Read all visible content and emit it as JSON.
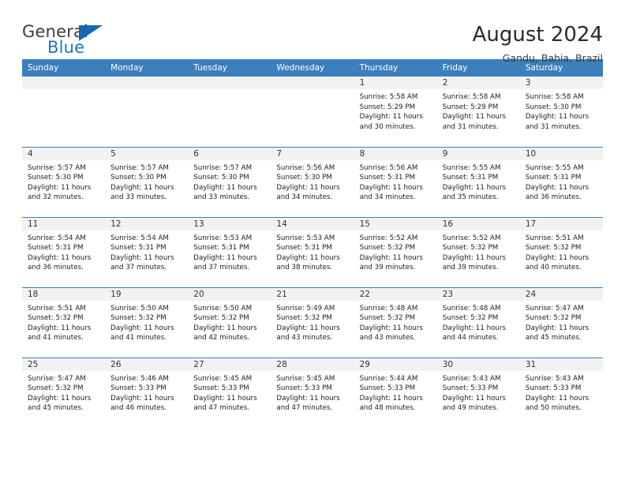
{
  "brand": {
    "word1": "General",
    "word2": "Blue",
    "triangle_color": "#1668b0"
  },
  "header": {
    "month_title": "August 2024",
    "location": "Gandu, Bahia, Brazil"
  },
  "colors": {
    "header_blue": "#3c7fbd",
    "date_band_gray": "#f2f2f2",
    "brand_blue": "#1c78c0"
  },
  "calendar": {
    "weekday_headers": [
      "Sunday",
      "Monday",
      "Tuesday",
      "Wednesday",
      "Thursday",
      "Friday",
      "Saturday"
    ],
    "weeks": [
      [
        {
          "day": "",
          "lines": []
        },
        {
          "day": "",
          "lines": []
        },
        {
          "day": "",
          "lines": []
        },
        {
          "day": "",
          "lines": []
        },
        {
          "day": "1",
          "lines": [
            "Sunrise: 5:58 AM",
            "Sunset: 5:29 PM",
            "Daylight: 11 hours",
            "and 30 minutes."
          ]
        },
        {
          "day": "2",
          "lines": [
            "Sunrise: 5:58 AM",
            "Sunset: 5:29 PM",
            "Daylight: 11 hours",
            "and 31 minutes."
          ]
        },
        {
          "day": "3",
          "lines": [
            "Sunrise: 5:58 AM",
            "Sunset: 5:30 PM",
            "Daylight: 11 hours",
            "and 31 minutes."
          ]
        }
      ],
      [
        {
          "day": "4",
          "lines": [
            "Sunrise: 5:57 AM",
            "Sunset: 5:30 PM",
            "Daylight: 11 hours",
            "and 32 minutes."
          ]
        },
        {
          "day": "5",
          "lines": [
            "Sunrise: 5:57 AM",
            "Sunset: 5:30 PM",
            "Daylight: 11 hours",
            "and 33 minutes."
          ]
        },
        {
          "day": "6",
          "lines": [
            "Sunrise: 5:57 AM",
            "Sunset: 5:30 PM",
            "Daylight: 11 hours",
            "and 33 minutes."
          ]
        },
        {
          "day": "7",
          "lines": [
            "Sunrise: 5:56 AM",
            "Sunset: 5:30 PM",
            "Daylight: 11 hours",
            "and 34 minutes."
          ]
        },
        {
          "day": "8",
          "lines": [
            "Sunrise: 5:56 AM",
            "Sunset: 5:31 PM",
            "Daylight: 11 hours",
            "and 34 minutes."
          ]
        },
        {
          "day": "9",
          "lines": [
            "Sunrise: 5:55 AM",
            "Sunset: 5:31 PM",
            "Daylight: 11 hours",
            "and 35 minutes."
          ]
        },
        {
          "day": "10",
          "lines": [
            "Sunrise: 5:55 AM",
            "Sunset: 5:31 PM",
            "Daylight: 11 hours",
            "and 36 minutes."
          ]
        }
      ],
      [
        {
          "day": "11",
          "lines": [
            "Sunrise: 5:54 AM",
            "Sunset: 5:31 PM",
            "Daylight: 11 hours",
            "and 36 minutes."
          ]
        },
        {
          "day": "12",
          "lines": [
            "Sunrise: 5:54 AM",
            "Sunset: 5:31 PM",
            "Daylight: 11 hours",
            "and 37 minutes."
          ]
        },
        {
          "day": "13",
          "lines": [
            "Sunrise: 5:53 AM",
            "Sunset: 5:31 PM",
            "Daylight: 11 hours",
            "and 37 minutes."
          ]
        },
        {
          "day": "14",
          "lines": [
            "Sunrise: 5:53 AM",
            "Sunset: 5:31 PM",
            "Daylight: 11 hours",
            "and 38 minutes."
          ]
        },
        {
          "day": "15",
          "lines": [
            "Sunrise: 5:52 AM",
            "Sunset: 5:32 PM",
            "Daylight: 11 hours",
            "and 39 minutes."
          ]
        },
        {
          "day": "16",
          "lines": [
            "Sunrise: 5:52 AM",
            "Sunset: 5:32 PM",
            "Daylight: 11 hours",
            "and 39 minutes."
          ]
        },
        {
          "day": "17",
          "lines": [
            "Sunrise: 5:51 AM",
            "Sunset: 5:32 PM",
            "Daylight: 11 hours",
            "and 40 minutes."
          ]
        }
      ],
      [
        {
          "day": "18",
          "lines": [
            "Sunrise: 5:51 AM",
            "Sunset: 5:32 PM",
            "Daylight: 11 hours",
            "and 41 minutes."
          ]
        },
        {
          "day": "19",
          "lines": [
            "Sunrise: 5:50 AM",
            "Sunset: 5:32 PM",
            "Daylight: 11 hours",
            "and 41 minutes."
          ]
        },
        {
          "day": "20",
          "lines": [
            "Sunrise: 5:50 AM",
            "Sunset: 5:32 PM",
            "Daylight: 11 hours",
            "and 42 minutes."
          ]
        },
        {
          "day": "21",
          "lines": [
            "Sunrise: 5:49 AM",
            "Sunset: 5:32 PM",
            "Daylight: 11 hours",
            "and 43 minutes."
          ]
        },
        {
          "day": "22",
          "lines": [
            "Sunrise: 5:48 AM",
            "Sunset: 5:32 PM",
            "Daylight: 11 hours",
            "and 43 minutes."
          ]
        },
        {
          "day": "23",
          "lines": [
            "Sunrise: 5:48 AM",
            "Sunset: 5:32 PM",
            "Daylight: 11 hours",
            "and 44 minutes."
          ]
        },
        {
          "day": "24",
          "lines": [
            "Sunrise: 5:47 AM",
            "Sunset: 5:32 PM",
            "Daylight: 11 hours",
            "and 45 minutes."
          ]
        }
      ],
      [
        {
          "day": "25",
          "lines": [
            "Sunrise: 5:47 AM",
            "Sunset: 5:32 PM",
            "Daylight: 11 hours",
            "and 45 minutes."
          ]
        },
        {
          "day": "26",
          "lines": [
            "Sunrise: 5:46 AM",
            "Sunset: 5:33 PM",
            "Daylight: 11 hours",
            "and 46 minutes."
          ]
        },
        {
          "day": "27",
          "lines": [
            "Sunrise: 5:45 AM",
            "Sunset: 5:33 PM",
            "Daylight: 11 hours",
            "and 47 minutes."
          ]
        },
        {
          "day": "28",
          "lines": [
            "Sunrise: 5:45 AM",
            "Sunset: 5:33 PM",
            "Daylight: 11 hours",
            "and 47 minutes."
          ]
        },
        {
          "day": "29",
          "lines": [
            "Sunrise: 5:44 AM",
            "Sunset: 5:33 PM",
            "Daylight: 11 hours",
            "and 48 minutes."
          ]
        },
        {
          "day": "30",
          "lines": [
            "Sunrise: 5:43 AM",
            "Sunset: 5:33 PM",
            "Daylight: 11 hours",
            "and 49 minutes."
          ]
        },
        {
          "day": "31",
          "lines": [
            "Sunrise: 5:43 AM",
            "Sunset: 5:33 PM",
            "Daylight: 11 hours",
            "and 50 minutes."
          ]
        }
      ]
    ]
  }
}
